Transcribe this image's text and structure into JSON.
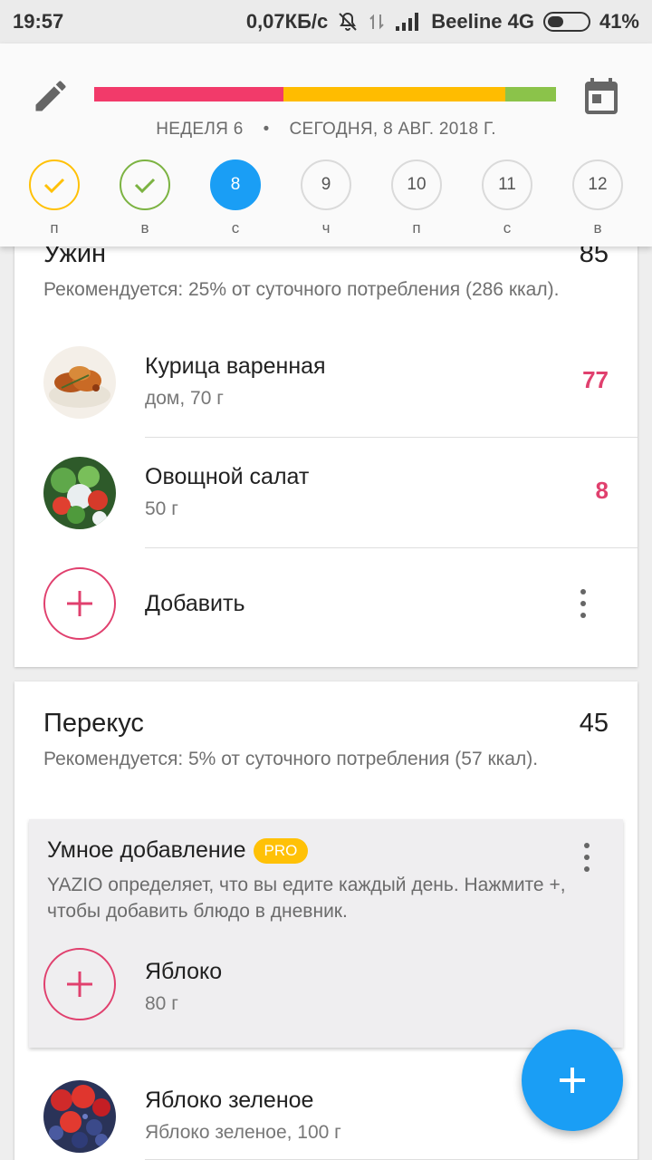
{
  "status_bar": {
    "time": "19:57",
    "speed": "0,07КБ/с",
    "carrier": "Beeline 4G",
    "battery": "41%",
    "battery_level": 0.41
  },
  "header": {
    "progress_colors": [
      "#f23a6a",
      "#ffbc00",
      "#8bc34a"
    ],
    "progress_fractions": [
      0.41,
      0.48,
      0.11
    ],
    "week_label": "НЕДЕЛЯ 6",
    "separator": "•",
    "date_label": "СЕГОДНЯ, 8 АВГ. 2018 Г.",
    "days": [
      {
        "num": "",
        "label": "п",
        "state": "done-yellow"
      },
      {
        "num": "",
        "label": "в",
        "state": "done-green"
      },
      {
        "num": "8",
        "label": "с",
        "state": "selected"
      },
      {
        "num": "9",
        "label": "ч",
        "state": "normal"
      },
      {
        "num": "10",
        "label": "п",
        "state": "normal"
      },
      {
        "num": "11",
        "label": "с",
        "state": "normal"
      },
      {
        "num": "12",
        "label": "в",
        "state": "normal"
      }
    ]
  },
  "dinner": {
    "title": "Ужин",
    "total": "85",
    "subtitle": "Рекомендуется: 25% от суточного потребления (286 ккал).",
    "items": [
      {
        "name": "Курица варенная",
        "detail": "дом, 70 г",
        "kcal": "77",
        "image": "roast-chicken"
      },
      {
        "name": "Овощной салат",
        "detail": "50 г",
        "kcal": "8",
        "image": "vegetable-salad"
      }
    ],
    "add_label": "Добавить"
  },
  "snack": {
    "title": "Перекус",
    "total": "45",
    "subtitle": "Рекомендуется: 5% от суточного потребления (57 ккал).",
    "smart_add": {
      "title": "Умное добавление",
      "badge": "PRO",
      "description": "YAZIO определяет, что вы едите каждый день. Нажмите +, чтобы добавить блюдо в дневник.",
      "suggestion_name": "Яблоко",
      "suggestion_detail": "80 г"
    },
    "items": [
      {
        "name": "Яблоко зеленое",
        "detail": "Яблоко зеленое, 100 г",
        "image": "berries"
      }
    ]
  },
  "colors": {
    "accent": "#e0406e",
    "fab": "#1a9ef5",
    "selected_day": "#1a9ef5",
    "pro_badge": "#ffc107"
  }
}
